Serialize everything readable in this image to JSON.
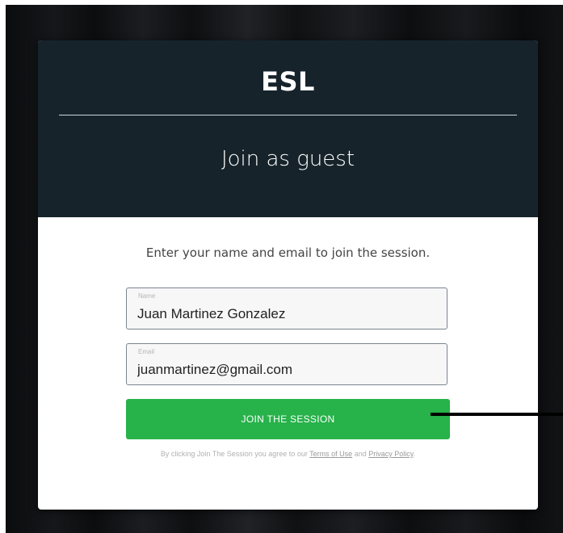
{
  "header": {
    "brand": "ESL",
    "title": "Join as guest"
  },
  "form": {
    "instructions": "Enter your name and email to join the session.",
    "name_field": {
      "label": "Name",
      "value": "Juan Martinez Gonzalez"
    },
    "email_field": {
      "label": "Email",
      "value": "juanmartinez@gmail.com"
    },
    "submit_label": "JOIN THE SESSION"
  },
  "legal": {
    "prefix": "By clicking Join The Session you agree to our ",
    "terms_link": "Terms of Use",
    "middle": " and ",
    "privacy_link": "Privacy Policy",
    "suffix": "."
  },
  "colors": {
    "header_background": "#16232a",
    "button_green": "#27b24a"
  }
}
